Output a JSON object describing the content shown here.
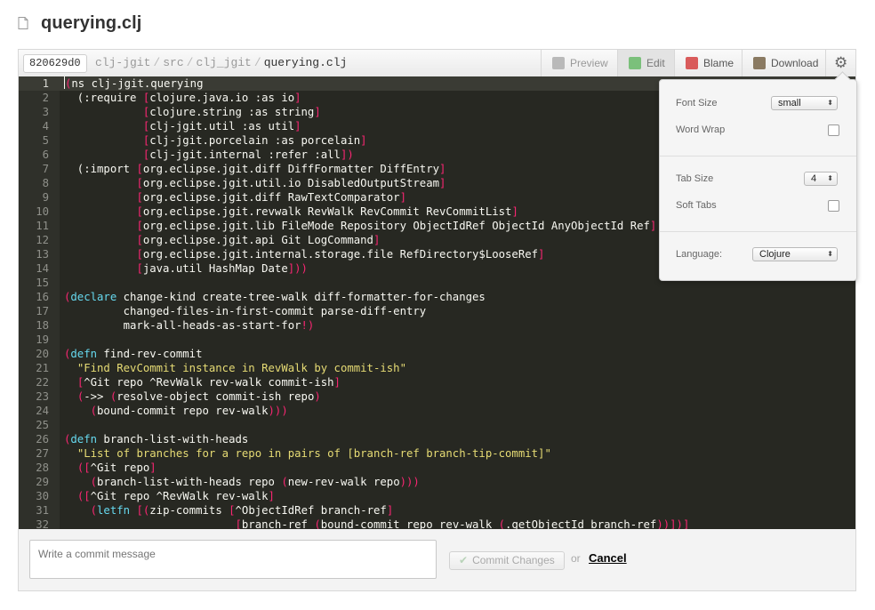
{
  "header": {
    "filename": "querying.clj"
  },
  "toolbar": {
    "sha": "820629d0",
    "breadcrumbs": [
      "clj-jgit",
      "src",
      "clj_jgit",
      "querying.clj"
    ],
    "separator": "/",
    "tabs": {
      "preview": "Preview",
      "edit": "Edit",
      "blame": "Blame",
      "download": "Download"
    },
    "gear_glyph": "⚙"
  },
  "editor": {
    "active_line": 1,
    "lines": [
      {
        "n": "1",
        "code": "<span class=\"br\">(</span>ns clj-jgit.querying"
      },
      {
        "n": "2",
        "code": "  (:require <span class=\"br\">[</span>clojure.java.io :as io<span class=\"br\">]</span>"
      },
      {
        "n": "3",
        "code": "            <span class=\"br\">[</span>clojure.string :as string<span class=\"br\">]</span>"
      },
      {
        "n": "4",
        "code": "            <span class=\"br\">[</span>clj-jgit.util :as util<span class=\"br\">]</span>"
      },
      {
        "n": "5",
        "code": "            <span class=\"br\">[</span>clj-jgit.porcelain :as porcelain<span class=\"br\">]</span>"
      },
      {
        "n": "6",
        "code": "            <span class=\"br\">[</span>clj-jgit.internal :refer :all<span class=\"br\">])</span>"
      },
      {
        "n": "7",
        "code": "  (:import <span class=\"br\">[</span>org.eclipse.jgit.diff DiffFormatter DiffEntry<span class=\"br\">]</span>"
      },
      {
        "n": "8",
        "code": "           <span class=\"br\">[</span>org.eclipse.jgit.util.io DisabledOutputStream<span class=\"br\">]</span>"
      },
      {
        "n": "9",
        "code": "           <span class=\"br\">[</span>org.eclipse.jgit.diff RawTextComparator<span class=\"br\">]</span>"
      },
      {
        "n": "10",
        "code": "           <span class=\"br\">[</span>org.eclipse.jgit.revwalk RevWalk RevCommit RevCommitList<span class=\"br\">]</span>"
      },
      {
        "n": "11",
        "code": "           <span class=\"br\">[</span>org.eclipse.jgit.lib FileMode Repository ObjectIdRef ObjectId AnyObjectId Ref<span class=\"br\">]</span>"
      },
      {
        "n": "12",
        "code": "           <span class=\"br\">[</span>org.eclipse.jgit.api Git LogCommand<span class=\"br\">]</span>"
      },
      {
        "n": "13",
        "code": "           <span class=\"br\">[</span>org.eclipse.jgit.internal.storage.file RefDirectory$LooseRef<span class=\"br\">]</span>"
      },
      {
        "n": "14",
        "code": "           <span class=\"br\">[</span>java.util HashMap Date<span class=\"br\">]))</span>"
      },
      {
        "n": "15",
        "code": ""
      },
      {
        "n": "16",
        "code": "<span class=\"br\">(</span><span class=\"kw\">declare</span> change-kind create-tree-walk diff-formatter-for-changes"
      },
      {
        "n": "17",
        "code": "         changed-files-in-first-commit parse-diff-entry"
      },
      {
        "n": "18",
        "code": "         mark-all-heads-as-start-for<span class=\"br\">!)</span>"
      },
      {
        "n": "19",
        "code": ""
      },
      {
        "n": "20",
        "code": "<span class=\"br\">(</span><span class=\"kw\">defn</span> find-rev-commit"
      },
      {
        "n": "21",
        "code": "  <span class=\"str\">\"Find RevCommit instance in RevWalk by commit-ish\"</span>"
      },
      {
        "n": "22",
        "code": "  <span class=\"br\">[</span>^Git repo ^RevWalk rev-walk commit-ish<span class=\"br\">]</span>"
      },
      {
        "n": "23",
        "code": "  <span class=\"br\">(</span>-&gt;&gt; <span class=\"br\">(</span>resolve-object commit-ish repo<span class=\"br\">)</span>"
      },
      {
        "n": "24",
        "code": "    <span class=\"br\">(</span>bound-commit repo rev-walk<span class=\"br\">)))</span>"
      },
      {
        "n": "25",
        "code": ""
      },
      {
        "n": "26",
        "code": "<span class=\"br\">(</span><span class=\"kw\">defn</span> branch-list-with-heads"
      },
      {
        "n": "27",
        "code": "  <span class=\"str\">\"List of branches for a repo in pairs of [branch-ref branch-tip-commit]\"</span>"
      },
      {
        "n": "28",
        "code": "  <span class=\"br\">([</span>^Git repo<span class=\"br\">]</span>"
      },
      {
        "n": "29",
        "code": "    <span class=\"br\">(</span>branch-list-with-heads repo <span class=\"br\">(</span>new-rev-walk repo<span class=\"br\">)))</span>"
      },
      {
        "n": "30",
        "code": "  <span class=\"br\">([</span>^Git repo ^RevWalk rev-walk<span class=\"br\">]</span>"
      },
      {
        "n": "31",
        "code": "    <span class=\"br\">(</span><span class=\"kw\">letfn</span> <span class=\"br\">[(</span>zip-commits <span class=\"br\">[</span>^ObjectIdRef branch-ref<span class=\"br\">]</span>"
      },
      {
        "n": "32",
        "code": "                          <span class=\"br\">[</span>branch-ref <span class=\"br\">(</span>bound-commit repo rev-walk <span class=\"br\">(</span>.getObjectId branch-ref<span class=\"br\">))])]</span>"
      }
    ]
  },
  "commit": {
    "placeholder": "Write a commit message",
    "button_label": "Commit Changes",
    "button_glyph": "✔",
    "or_label": "or",
    "cancel_label": "Cancel"
  },
  "settings": {
    "font_size_label": "Font Size",
    "font_size_value": "small",
    "word_wrap_label": "Word Wrap",
    "word_wrap_checked": false,
    "tab_size_label": "Tab Size",
    "tab_size_value": "4",
    "soft_tabs_label": "Soft Tabs",
    "soft_tabs_checked": false,
    "language_label": "Language:",
    "language_value": "Clojure",
    "select_arrow": "⬍"
  },
  "colors": {
    "editor_bg": "#272822",
    "gutter_bg": "#2f302a",
    "bracket": "#f92672",
    "keyword": "#66d9ef",
    "string": "#e6db74",
    "text": "#f8f8f2"
  }
}
